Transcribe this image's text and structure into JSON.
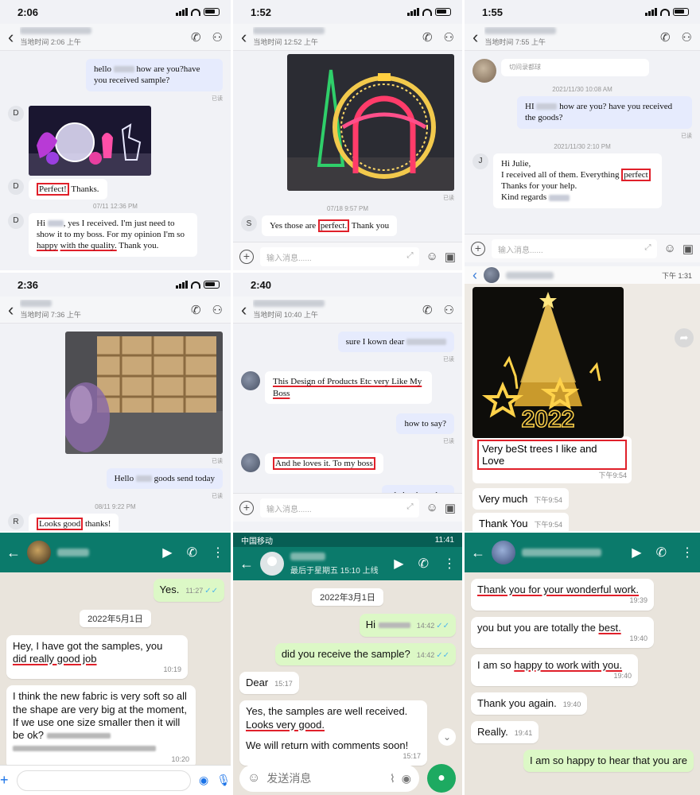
{
  "p1": {
    "clock": "2:06",
    "local_time": "当地时间 2:06 上午",
    "msg1": "hello",
    "msg1b": "how are you?have you received sample?",
    "read1": "已读",
    "sender1": "D",
    "sender2": "D",
    "msg2_boxed": "Perfect!",
    "msg2_rest": " Thanks.",
    "time1": "07/11 12:36 PM",
    "sender3": "D",
    "msg3_a": "Hi",
    "msg3_b": ", yes I received. I'm just need to show it to my boss.  For my opinion I'm so",
    "msg3_happy": "happy",
    "msg3_c": "with the quality.",
    "msg3_d": " Thank you."
  },
  "p2": {
    "clock": "1:52",
    "local_time": "当地时间 12:52 上午",
    "read": "已读",
    "time1": "07/18 9:57 PM",
    "sender": "S",
    "msg_a": "Yes those are",
    "msg_boxed": "perfect.",
    "msg_b": " Thank you",
    "input_placeholder": "输入消息......"
  },
  "p3": {
    "clock": "1:55",
    "local_time": "当地时间 7:55 上午",
    "top_text": "切间录都球",
    "time1": "2021/11/30 10:08 AM",
    "msg1_a": "HI",
    "msg1_b": " how are you? have you received the goods?",
    "read": "已读",
    "time2": "2021/11/30 2:10 PM",
    "sender": "J",
    "msg2_l1": "Hi Julie,",
    "msg2_l2": "I received all of them. Everything",
    "msg2_boxed": "perfect",
    "msg2_l3": "Thanks for your help.",
    "msg2_l4": "Kind regards",
    "input_placeholder": "输入消息......"
  },
  "p4": {
    "clock": "2:36",
    "local_time": "当地时间 7:36 上午",
    "read1": "已读",
    "msg1_a": "Hello",
    "msg1_b": " goods send today",
    "read2": "已读",
    "time1": "08/11 9:22 PM",
    "sender": "R",
    "msg2_boxed": "Looks good",
    "msg2_rest": " thanks!"
  },
  "p5": {
    "clock": "2:40",
    "local_time": "当地时间 10:40 上午",
    "msg1": "sure  I kown  dear",
    "read1": "已读",
    "msg2": "This Design of Products  Etc very Like My Boss",
    "msg3": "how to say?",
    "read2": "已读",
    "msg4": "And he loves it.  To my boss",
    "msg5": "glad to hear that",
    "input_placeholder": "输入消息......"
  },
  "p6": {
    "time0": "下午 1:31",
    "msg1": "Very beSt trees  I like and Love",
    "time1": "下午9:54",
    "msg2": "Very much",
    "time2": "下午9:54",
    "msg3": "Thank You",
    "time3": "下午9:54",
    "tree_text": "2022"
  },
  "p7": {
    "msg1": "Yes.",
    "t1": "11:27",
    "date": "2022年5月1日",
    "msg2_a": "Hey, I have got the samples, you",
    "msg2_b": "did really good job",
    "t2": "10:19",
    "msg3": "I think the new fabric is very soft so all the shape are very big at the moment, If we use one size smaller then it will be ok?",
    "t3": "10:20"
  },
  "p8": {
    "carrier": "中国移动",
    "clock": "11:41",
    "last_seen": "最后于星期五 15:10 上线",
    "date": "2022年3月1日",
    "msg1": "Hi",
    "t1": "14:42",
    "msg2": "did you receive the sample?",
    "t2": "14:42",
    "msg3": "Dear",
    "t3": "15:17",
    "msg4_a": "Yes, the samples are well received.",
    "msg4_b": "Looks very good.",
    "msg4_c": "We will return with comments soon!",
    "t4": "15:17",
    "input_placeholder": "发送消息"
  },
  "p9": {
    "msg1": "Thank you for your wonderful work.",
    "t1": "19:39",
    "msg2_a": "you but you are totally the",
    "msg2_b": "best.",
    "t2": "19:40",
    "msg3_a": "I am so",
    "msg3_b": "happy to work with you.",
    "t3": "19:40",
    "msg4": "Thank you again.",
    "t4": "19:40",
    "msg5": "Really.",
    "t5": "19:41",
    "msg6": "I am so happy to hear that you are"
  },
  "colors": {
    "highlight": "#e0202a",
    "wa_header": "#0b7a6b",
    "wa_out": "#dcf8c6",
    "im_out": "#e6ebfd"
  }
}
